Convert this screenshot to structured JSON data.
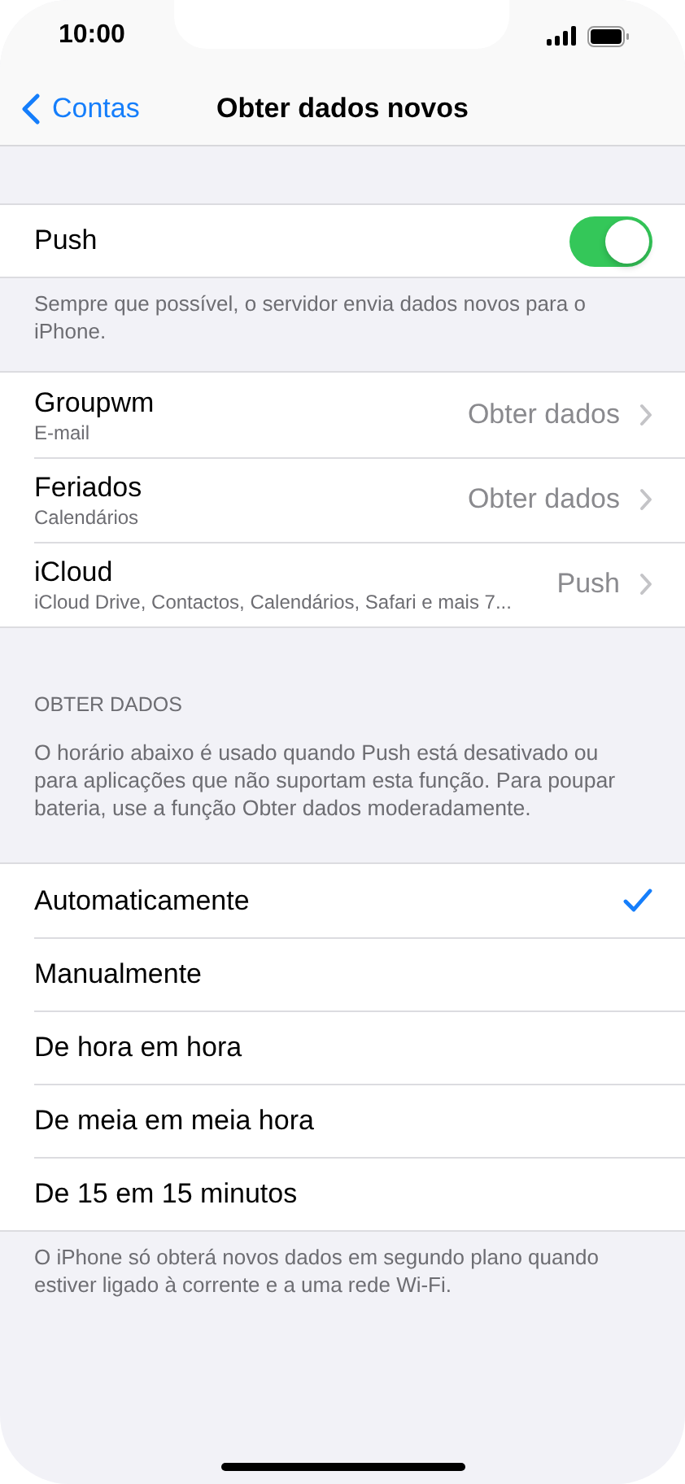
{
  "status_bar": {
    "time": "10:00"
  },
  "nav": {
    "back": "Contas",
    "title": "Obter dados novos"
  },
  "push": {
    "label": "Push",
    "on": true
  },
  "push_footer": "Sempre que possível, o servidor envia dados novos para o iPhone.",
  "accounts": [
    {
      "name": "Groupwm",
      "subtitle": "E-mail",
      "value": "Obter dados"
    },
    {
      "name": "Feriados",
      "subtitle": "Calendários",
      "value": "Obter dados"
    },
    {
      "name": "iCloud",
      "subtitle": "iCloud Drive, Contactos, Calendários, Safari e mais 7...",
      "value": "Push"
    }
  ],
  "section_header": "OBTER DADOS",
  "section_description": "O horário abaixo é usado quando Push está desativado ou para aplicações que não suportam esta função. Para poupar bateria, use a função Obter dados moderadamente.",
  "options": [
    {
      "label": "Automaticamente",
      "selected": true
    },
    {
      "label": "Manualmente",
      "selected": false
    },
    {
      "label": "De hora em hora",
      "selected": false
    },
    {
      "label": "De meia em meia hora",
      "selected": false
    },
    {
      "label": "De 15 em 15 minutos",
      "selected": false
    }
  ],
  "footer": "O iPhone só obterá novos dados em segundo plano quando estiver ligado à corrente e a uma rede Wi-Fi."
}
